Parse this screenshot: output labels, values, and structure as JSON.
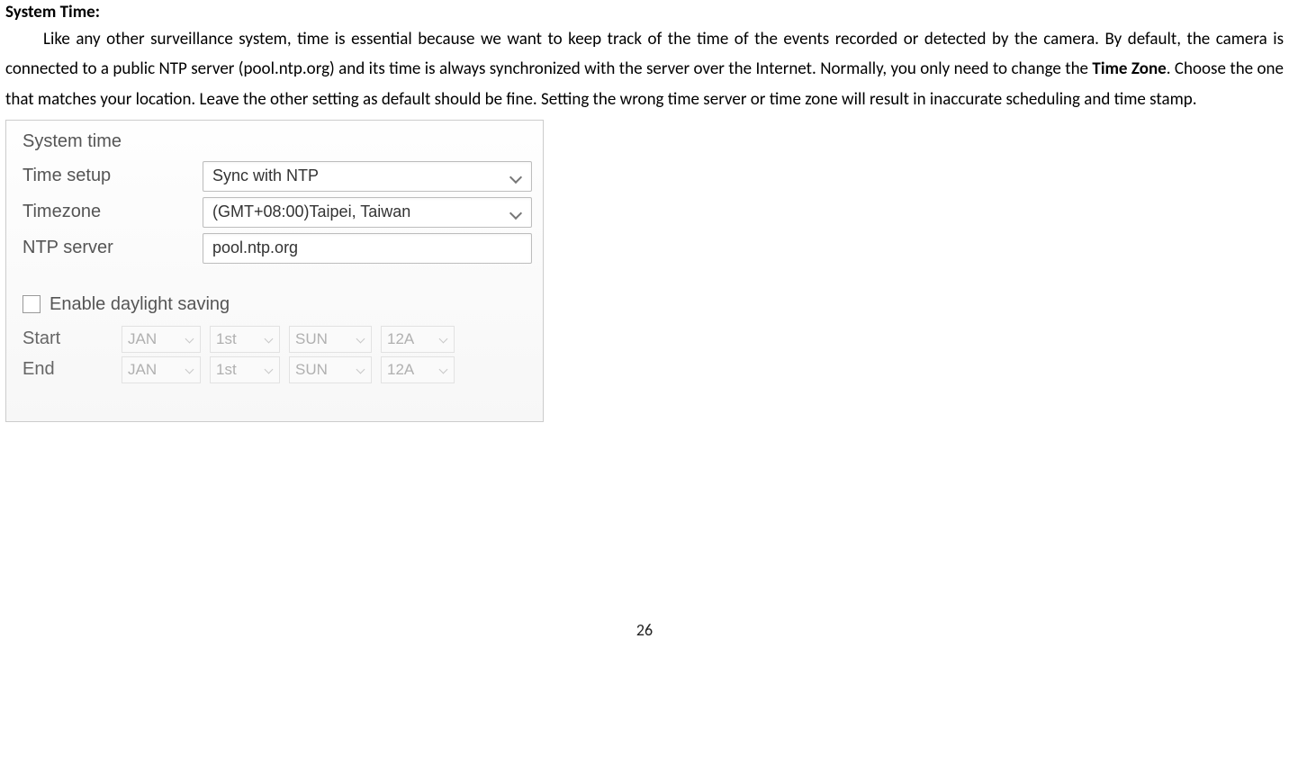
{
  "doc": {
    "heading_prefix": "System Time",
    "heading_suffix": ":",
    "para_before_bold": "Like any other surveillance system, time is essential because we want to keep track of the time of the events recorded or detected by the camera. By default, the camera is connected to a public NTP server (pool.ntp.org) and its time is always synchronized with the server over the Internet. Normally, you only need to change the ",
    "para_bold": "Time Zone",
    "para_after_bold": ". Choose the one that matches your location. Leave the other setting as default should be fine. Setting the wrong time server or time zone will result in inaccurate scheduling and time stamp.",
    "page_number": "26"
  },
  "panel": {
    "section_title": "System time",
    "rows": {
      "time_setup": {
        "label": "Time setup",
        "value": "Sync with NTP"
      },
      "timezone": {
        "label": "Timezone",
        "value": "(GMT+08:00)Taipei, Taiwan"
      },
      "ntp_server": {
        "label": "NTP server",
        "value": "pool.ntp.org"
      }
    },
    "dst": {
      "checkbox_label": "Enable daylight saving",
      "checked": false,
      "start": {
        "label": "Start",
        "month": "JAN",
        "week": "1st",
        "day": "SUN",
        "hour": "12A"
      },
      "end": {
        "label": "End",
        "month": "JAN",
        "week": "1st",
        "day": "SUN",
        "hour": "12A"
      }
    }
  }
}
